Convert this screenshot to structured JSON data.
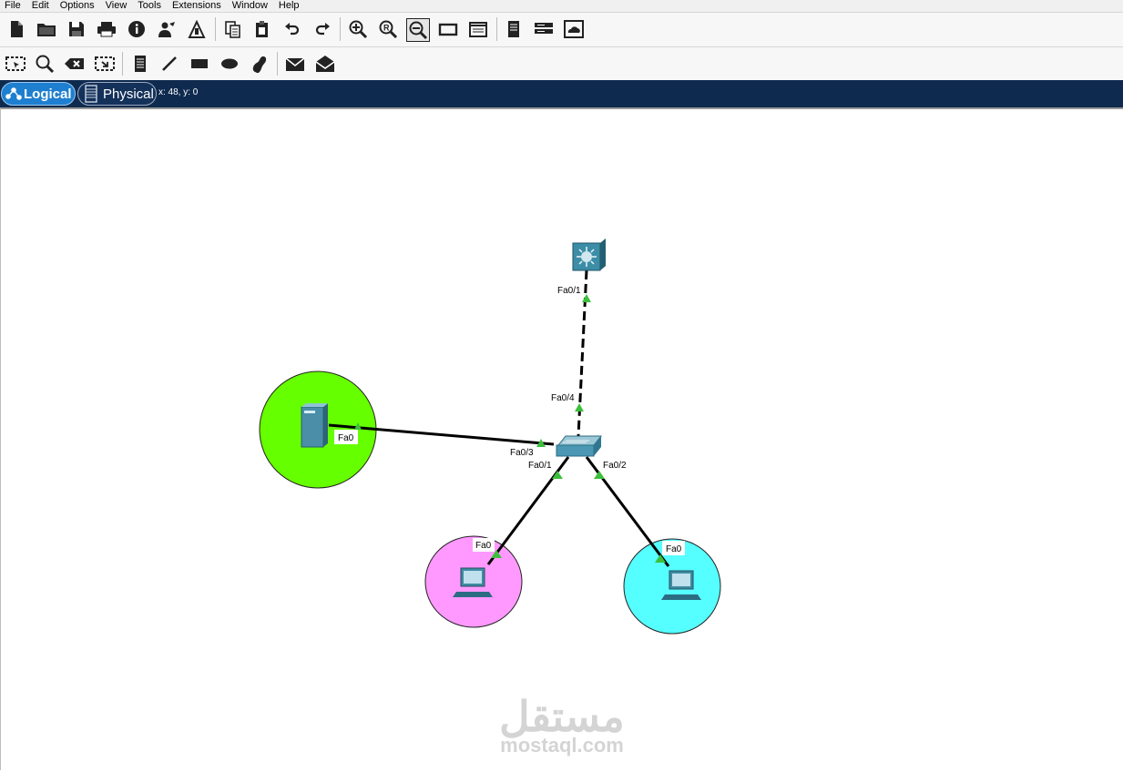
{
  "menu": [
    "File",
    "Edit",
    "Options",
    "View",
    "Tools",
    "Extensions",
    "Window",
    "Help"
  ],
  "toolbar_main": [
    {
      "name": "new-file-icon",
      "active": false
    },
    {
      "name": "open-folder-icon",
      "active": false
    },
    {
      "name": "save-icon",
      "active": false
    },
    {
      "name": "print-icon",
      "active": false
    },
    {
      "name": "info-icon",
      "active": false
    },
    {
      "name": "activity-wizard-icon",
      "active": false
    },
    {
      "name": "network-info-icon",
      "active": false
    },
    {
      "name": "copy-icon",
      "active": false
    },
    {
      "name": "paste-icon",
      "active": false
    },
    {
      "name": "undo-icon",
      "active": false
    },
    {
      "name": "redo-icon",
      "active": false
    },
    {
      "name": "zoom-in-icon",
      "active": false
    },
    {
      "name": "zoom-reset-icon",
      "active": false
    },
    {
      "name": "zoom-out-icon",
      "active": true
    },
    {
      "name": "drawing-palette-icon",
      "active": false
    },
    {
      "name": "custom-device-dialog-icon",
      "active": false
    },
    {
      "name": "view-command-log-icon",
      "active": false
    },
    {
      "name": "device-list-icon",
      "active": false
    },
    {
      "name": "cloud-icon",
      "active": false
    }
  ],
  "toolbar_tools": [
    {
      "name": "select-icon"
    },
    {
      "name": "inspect-icon"
    },
    {
      "name": "delete-icon"
    },
    {
      "name": "resize-shape-icon"
    },
    {
      "name": "place-note-icon"
    },
    {
      "name": "draw-line-icon"
    },
    {
      "name": "draw-rectangle-icon"
    },
    {
      "name": "draw-ellipse-icon"
    },
    {
      "name": "draw-freeform-icon"
    },
    {
      "name": "add-simple-pdu-icon"
    },
    {
      "name": "add-complex-pdu-icon"
    }
  ],
  "tabs": {
    "logical": "Logical",
    "physical": "Physical"
  },
  "coords": "x: 48, y: 0",
  "topology": {
    "labels": {
      "mls_port": "Fa0/1",
      "switch_uplink": "Fa0/4",
      "switch_server_port": "Fa0/3",
      "switch_pc1_port": "Fa0/1",
      "switch_pc2_port": "Fa0/2",
      "server_port": "Fa0",
      "pc1_port": "Fa0",
      "pc2_port": "Fa0"
    },
    "zone_colors": {
      "server": "#66ff00",
      "pc1": "#ff99ff",
      "pc2": "#55ffff"
    },
    "link_status_color": "#3dbf3d"
  },
  "watermark": {
    "arabic": "مستقل",
    "domain": "mostaql.com"
  }
}
